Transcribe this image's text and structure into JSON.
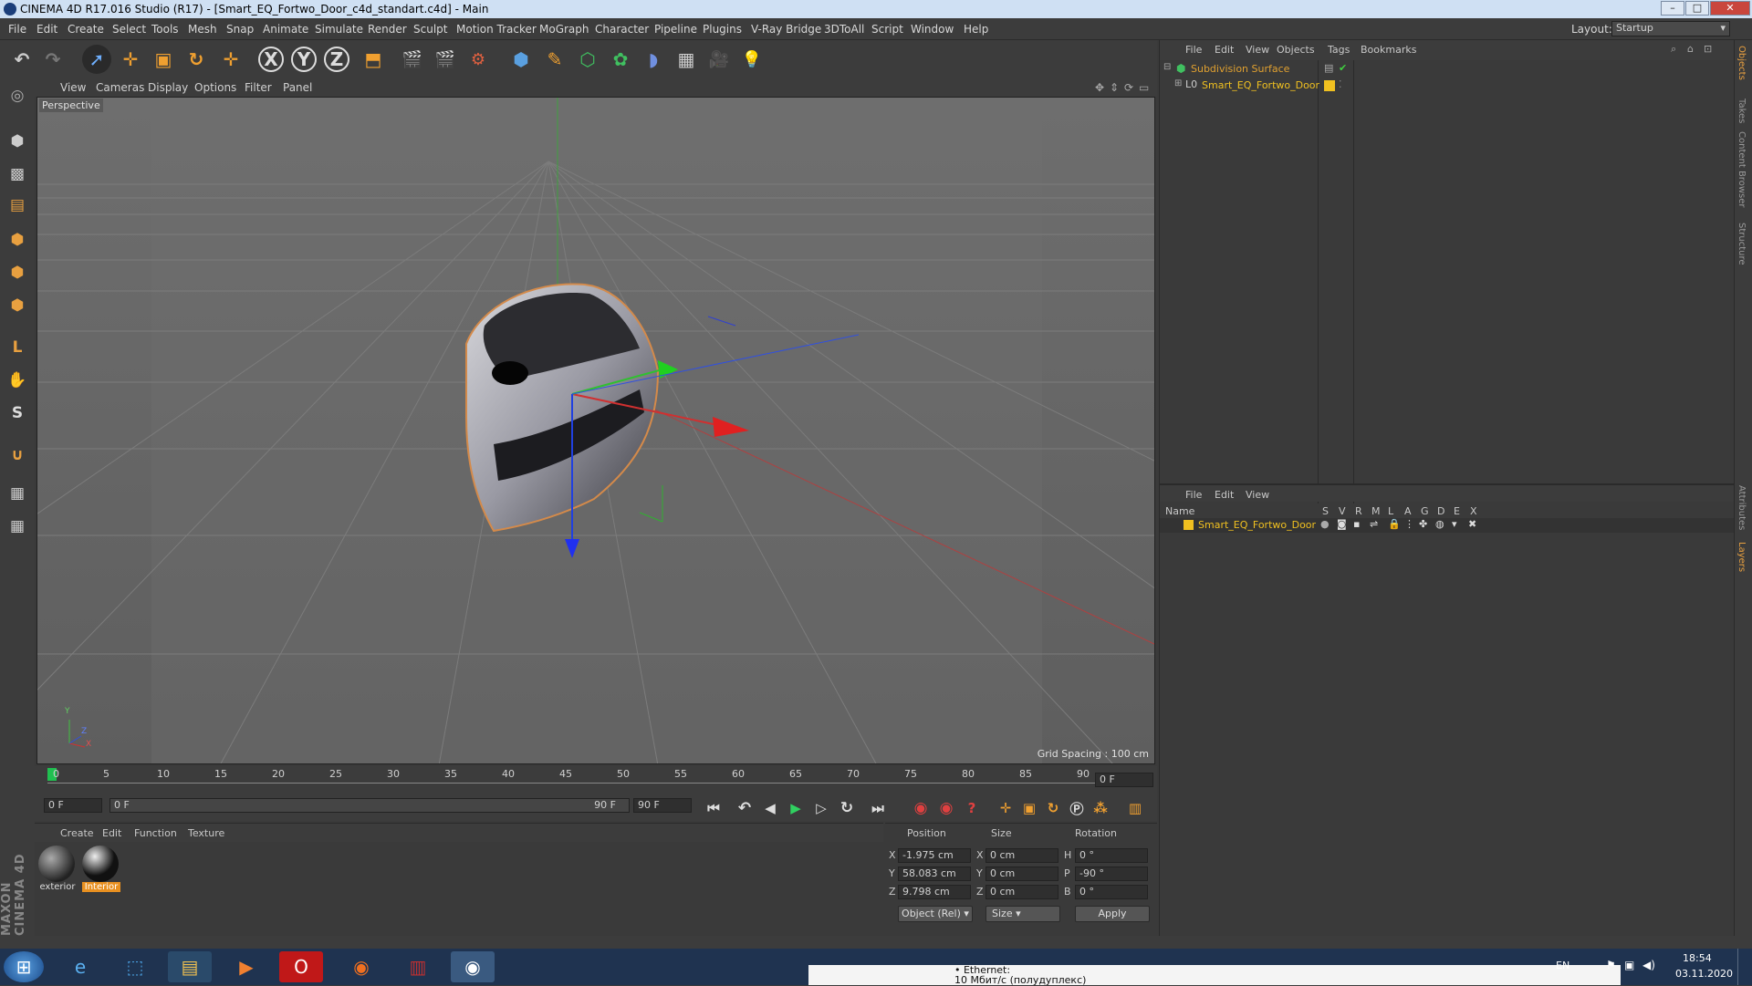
{
  "window": {
    "title": "CINEMA 4D R17.016 Studio (R17) - [Smart_EQ_Fortwo_Door_c4d_standart.c4d] - Main",
    "minimize": "–",
    "maximize": "□",
    "close": "✕"
  },
  "menu": [
    "File",
    "Edit",
    "Create",
    "Select",
    "Tools",
    "Mesh",
    "Snap",
    "Animate",
    "Simulate",
    "Render",
    "Sculpt",
    "Motion Tracker",
    "MoGraph",
    "Character",
    "Pipeline",
    "Plugins",
    "V-Ray Bridge",
    "3DToAll",
    "Script",
    "Window",
    "Help"
  ],
  "layout": {
    "label": "Layout:",
    "value": "Startup"
  },
  "toolbar": {
    "undo": "↶",
    "redo": "↷",
    "select": "➚",
    "move": "✛",
    "scale": "▣",
    "rotate": "↻",
    "place": "✛",
    "x": "X",
    "y": "Y",
    "z": "Z",
    "coord": "⬒",
    "render_view": "🎬",
    "render_pic": "🎬",
    "render_settings": "⚙",
    "cube": "⬢",
    "pen": "✎",
    "subdiv": "⬡",
    "cloner": "✿",
    "deformer": "◗",
    "floor": "▦",
    "camera": "🎥",
    "light": "💡"
  },
  "viewport": {
    "menu": [
      "View",
      "Cameras",
      "Display",
      "Options",
      "Filter",
      "Panel"
    ],
    "label": "Perspective",
    "grid_spacing": "Grid Spacing : 100 cm",
    "axis_y": "Y",
    "axis_z": "Z",
    "axis_x": "X"
  },
  "timeline": {
    "ticks": [
      "0",
      "5",
      "10",
      "15",
      "20",
      "25",
      "30",
      "35",
      "40",
      "45",
      "50",
      "55",
      "60",
      "65",
      "70",
      "75",
      "80",
      "85",
      "90"
    ],
    "current_frame": "0 F",
    "start_field": "0 F",
    "range_start": "0 F",
    "range_end": "90 F",
    "end_field": "90 F"
  },
  "materials": {
    "menu": [
      "Create",
      "Edit",
      "Function",
      "Texture"
    ],
    "items": [
      {
        "name": "exterior"
      },
      {
        "name": "Interior"
      }
    ]
  },
  "coords": {
    "headers": [
      "Position",
      "Size",
      "Rotation"
    ],
    "rows": [
      {
        "axis": "X",
        "pos": "-1.975 cm",
        "size_axis": "X",
        "size": "0 cm",
        "rot_axis": "H",
        "rot": "0 °"
      },
      {
        "axis": "Y",
        "pos": "58.083 cm",
        "size_axis": "Y",
        "size": "0 cm",
        "rot_axis": "P",
        "rot": "-90 °"
      },
      {
        "axis": "Z",
        "pos": "9.798 cm",
        "size_axis": "Z",
        "size": "0 cm",
        "rot_axis": "B",
        "rot": "0 °"
      }
    ],
    "mode": "Object (Rel)",
    "size_mode": "Size",
    "apply": "Apply"
  },
  "objects": {
    "menu": [
      "File",
      "Edit",
      "View",
      "Objects",
      "Tags",
      "Bookmarks"
    ],
    "tree": [
      {
        "name": "Subdivision Surface",
        "color": "#e0a030"
      },
      {
        "name": "Smart_EQ_Fortwo_Door",
        "color": "#f0c020"
      }
    ]
  },
  "layers": {
    "menu": [
      "File",
      "Edit",
      "View"
    ],
    "name_header": "Name",
    "flags": [
      "S",
      "V",
      "R",
      "M",
      "L",
      "A",
      "G",
      "D",
      "E",
      "X"
    ],
    "rows": [
      {
        "name": "Smart_EQ_Fortwo_Door"
      }
    ]
  },
  "side_tabs": [
    "Objects",
    "Takes",
    "Content Browser",
    "Structure",
    "Attributes",
    "Layers"
  ],
  "brand": "MAXON CINEMA 4D",
  "taskbar": {
    "lang": "EN",
    "time": "18:54",
    "date": "03.11.2020",
    "popup_line1": "• Ethernet:",
    "popup_line2": "10 Мбит/с (полудуплекс)"
  }
}
